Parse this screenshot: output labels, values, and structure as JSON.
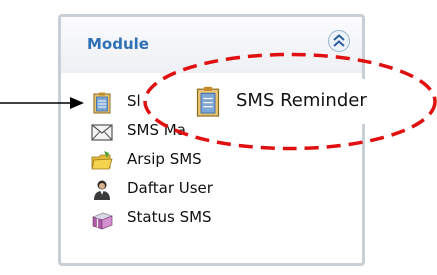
{
  "panel": {
    "title": "Module"
  },
  "menu": {
    "items": [
      {
        "label": "SMS Reminder",
        "visible_text": "Sl",
        "icon": "calendar-icon"
      },
      {
        "label": "SMS Masuk",
        "visible_text": "SMS Ma",
        "icon": "envelope-icon"
      },
      {
        "label": "Arsip SMS",
        "visible_text": "Arsip SMS",
        "icon": "folder-icon"
      },
      {
        "label": "Daftar User",
        "visible_text": "Daftar User",
        "icon": "user-icon"
      },
      {
        "label": "Status SMS",
        "visible_text": "Status SMS",
        "icon": "gift-box-icon"
      }
    ]
  },
  "tooltip": {
    "label": "SMS Reminder",
    "icon": "calendar-icon"
  },
  "colors": {
    "title": "#2f6fb4",
    "highlight_ellipse": "#e01010",
    "panel_border": "#c9cfd6"
  }
}
